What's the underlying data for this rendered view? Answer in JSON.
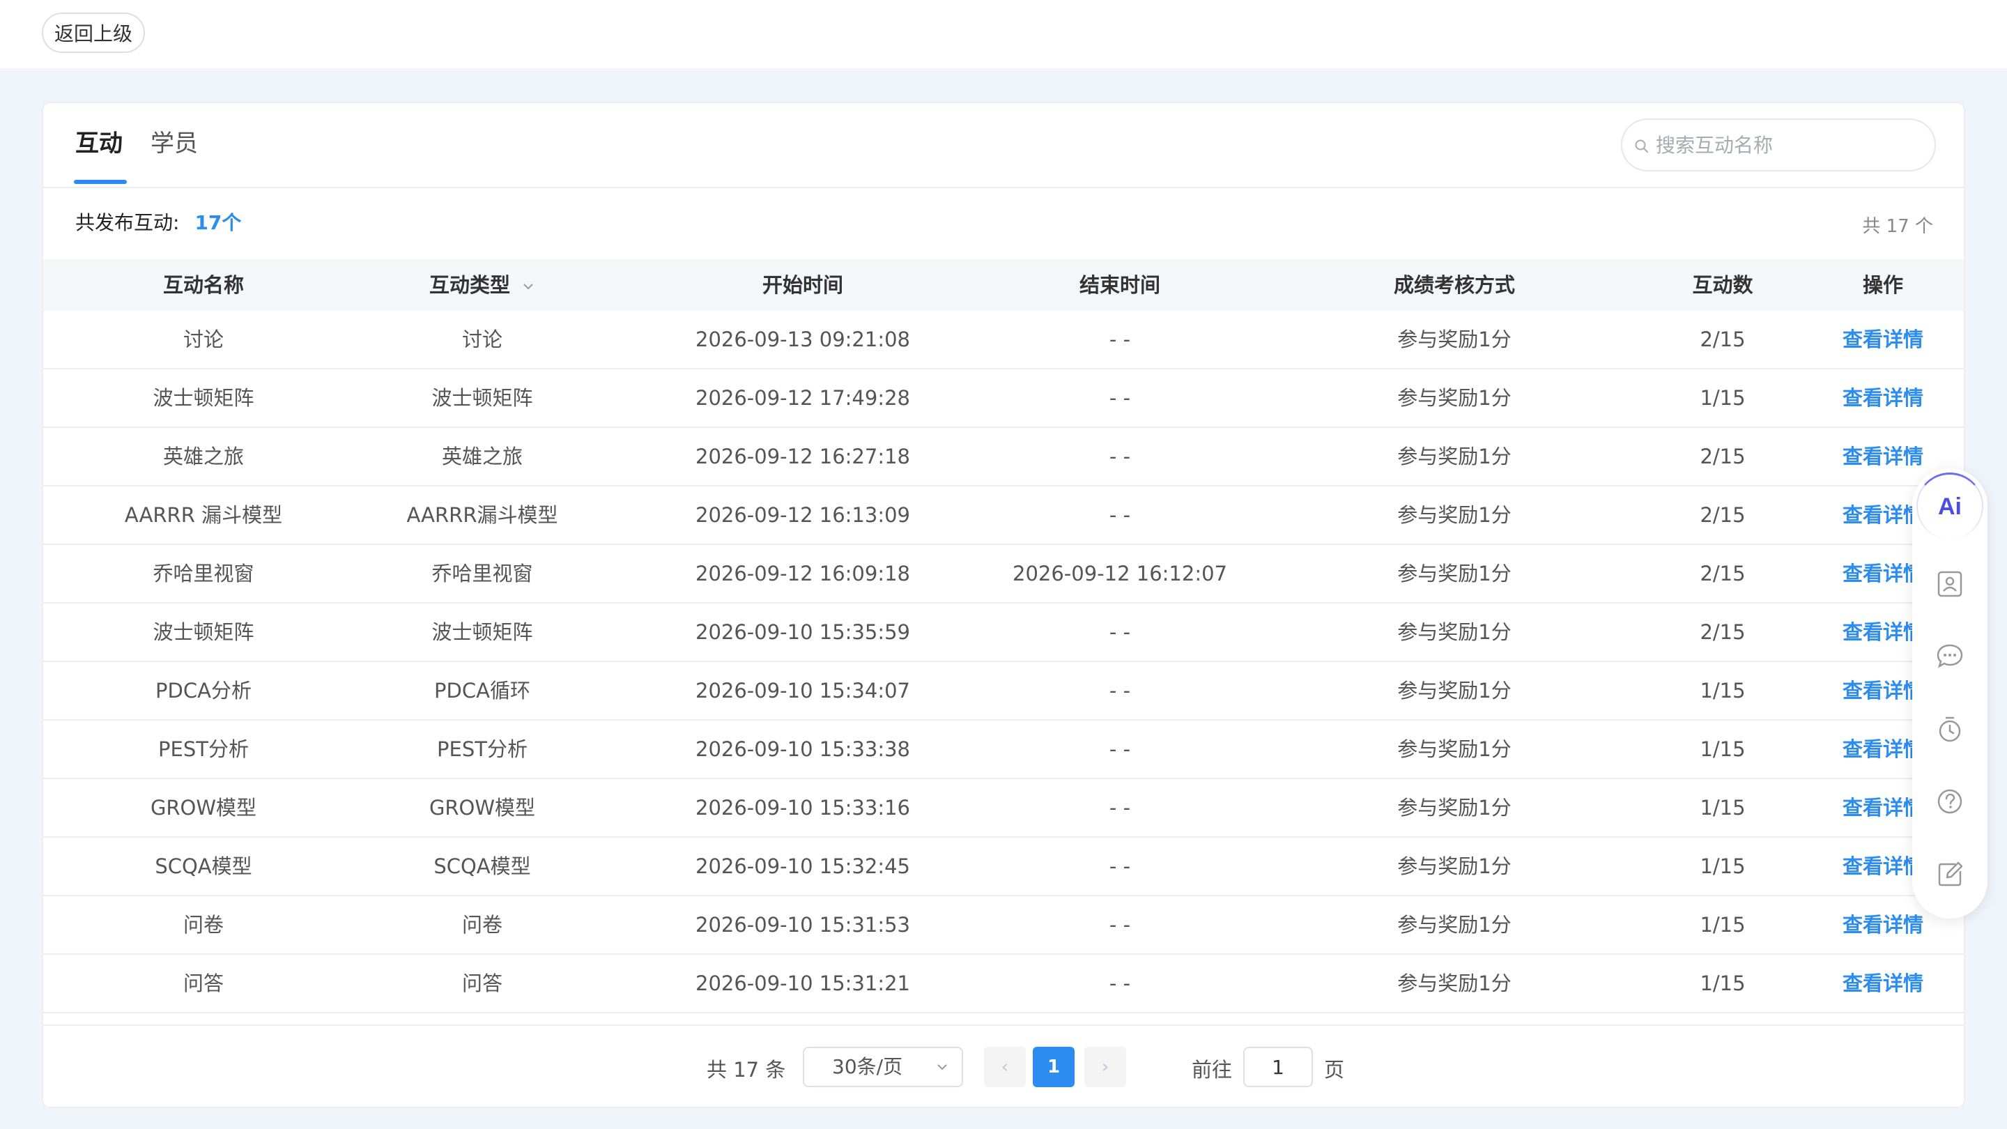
{
  "topbar": {
    "back_label": "返回上级"
  },
  "tabs": [
    {
      "label": "互动",
      "active": true
    },
    {
      "label": "学员",
      "active": false
    }
  ],
  "search": {
    "placeholder": "搜索互动名称",
    "value": ""
  },
  "summary": {
    "label": "共发布互动:",
    "count": "17个",
    "total_right": "共 17 个"
  },
  "table": {
    "headers": [
      "互动名称",
      "互动类型",
      "开始时间",
      "结束时间",
      "成绩考核方式",
      "互动数",
      "操作"
    ],
    "rows": [
      [
        "讨论",
        "讨论",
        "2026-09-13 09:21:08",
        "- -",
        "参与奖励1分",
        "2/15",
        "查看详情"
      ],
      [
        "波士顿矩阵",
        "波士顿矩阵",
        "2026-09-12 17:49:28",
        "- -",
        "参与奖励1分",
        "1/15",
        "查看详情"
      ],
      [
        "英雄之旅",
        "英雄之旅",
        "2026-09-12 16:27:18",
        "- -",
        "参与奖励1分",
        "2/15",
        "查看详情"
      ],
      [
        "AARRR 漏斗模型",
        "AARRR漏斗模型",
        "2026-09-12 16:13:09",
        "- -",
        "参与奖励1分",
        "2/15",
        "查看详情"
      ],
      [
        "乔哈里视窗",
        "乔哈里视窗",
        "2026-09-12 16:09:18",
        "2026-09-12 16:12:07",
        "参与奖励1分",
        "2/15",
        "查看详情"
      ],
      [
        "波士顿矩阵",
        "波士顿矩阵",
        "2026-09-10 15:35:59",
        "- -",
        "参与奖励1分",
        "2/15",
        "查看详情"
      ],
      [
        "PDCA分析",
        "PDCA循环",
        "2026-09-10 15:34:07",
        "- -",
        "参与奖励1分",
        "1/15",
        "查看详情"
      ],
      [
        "PEST分析",
        "PEST分析",
        "2026-09-10 15:33:38",
        "- -",
        "参与奖励1分",
        "1/15",
        "查看详情"
      ],
      [
        "GROW模型",
        "GROW模型",
        "2026-09-10 15:33:16",
        "- -",
        "参与奖励1分",
        "1/15",
        "查看详情"
      ],
      [
        "SCQA模型",
        "SCQA模型",
        "2026-09-10 15:32:45",
        "- -",
        "参与奖励1分",
        "1/15",
        "查看详情"
      ],
      [
        "问卷",
        "问卷",
        "2026-09-10 15:31:53",
        "- -",
        "参与奖励1分",
        "1/15",
        "查看详情"
      ],
      [
        "问答",
        "问答",
        "2026-09-10 15:31:21",
        "- -",
        "参与奖励1分",
        "1/15",
        "查看详情"
      ]
    ]
  },
  "pagination": {
    "total": "共 17 条",
    "page_size": "30条/页",
    "prev": "‹",
    "current": "1",
    "next": "›",
    "goto_label": "前往",
    "goto_value": "1",
    "page_label": "页"
  },
  "sidebar": {
    "ai_label": "Ai",
    "icons": [
      "ai-icon",
      "contact-card-icon",
      "chat-icon",
      "timer-icon",
      "help-icon",
      "edit-icon"
    ]
  },
  "colors": {
    "accent": "#2d8cf0",
    "background": "#f0f5fb",
    "header_bg": "#f5f6f8"
  }
}
